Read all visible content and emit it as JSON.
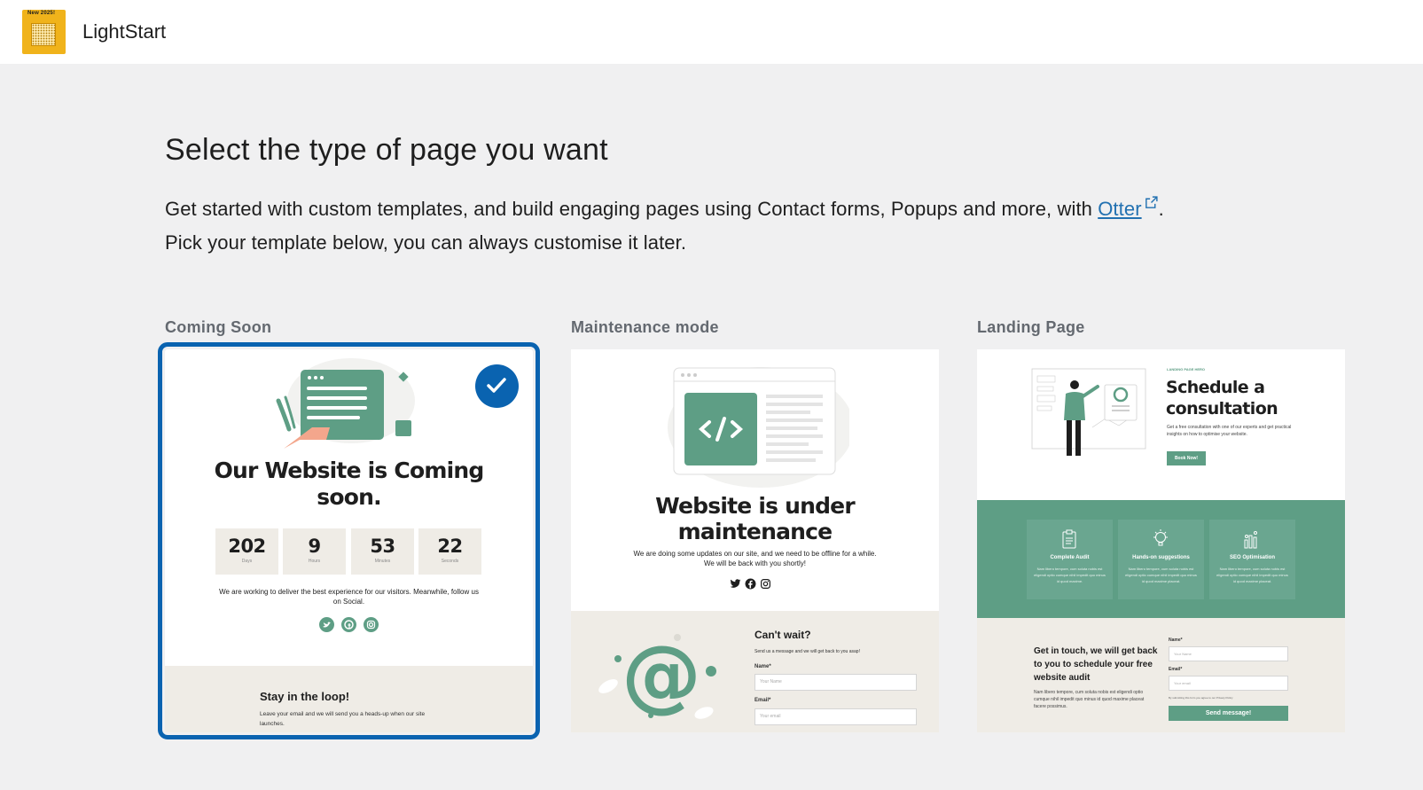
{
  "app": {
    "name": "LightStart",
    "logo_badge": "New 2025!"
  },
  "main": {
    "heading": "Select the type of page you want",
    "description_before_link": "Get started with custom templates, and build engaging pages using Contact forms, Popups and more, with ",
    "link_text": "Otter",
    "description_after_link": ".",
    "description_line2": "Pick your template below, you can always customise it later."
  },
  "templates": [
    {
      "label": "Coming Soon",
      "selected": true,
      "preview": {
        "title": "Our Website is Coming soon.",
        "countdown": [
          {
            "value": "202",
            "unit": "Days"
          },
          {
            "value": "9",
            "unit": "Hours"
          },
          {
            "value": "53",
            "unit": "Minutes"
          },
          {
            "value": "22",
            "unit": "Seconds"
          }
        ],
        "text": "We are working to deliver the best experience for our visitors. Meanwhile, follow us on Social.",
        "footer_title": "Stay in the loop!",
        "footer_text": "Leave your email and we will send you a heads-up when our site launches."
      }
    },
    {
      "label": "Maintenance mode",
      "selected": false,
      "preview": {
        "title": "Website is under maintenance",
        "text": "We are doing some updates on our site, and we need to be offline for a while. We will be back with you shortly!",
        "contact_title": "Can't wait?",
        "contact_text": "Send us a message and we will get back to you asap!",
        "name_label": "Name*",
        "name_placeholder": "Your Name",
        "email_label": "Email*",
        "email_placeholder": "Your email"
      }
    },
    {
      "label": "Landing Page",
      "selected": false,
      "preview": {
        "eyebrow": "LANDING PAGE HERO",
        "title": "Schedule a consultation",
        "text": "Get a free consultation with one of our experts and get practical insights on how to optimise your website.",
        "button": "Book Now!",
        "features": [
          {
            "title": "Complete Audit",
            "text": "Nam libero tempore, cum soluta nobis est eligendi optio cumque nihil impedit quo minus id quod maxime."
          },
          {
            "title": "Hands-on suggestions",
            "text": "Nam libero tempore, cum soluta nobis est eligendi optio cumque nihil impedit quo minus id quod maxime placeat."
          },
          {
            "title": "SEO Optimisation",
            "text": "Nam libero tempore, cum soluta nobis est eligendi optio cumque nihil impedit quo minus id quod maxime placeat."
          }
        ],
        "contact_title": "Get in touch, we will get back to you to schedule your free website audit",
        "contact_text": "Nam libero tempore, cum soluta nobis est eligendi optio cumque nihil impedit quo minus id quod maxime placeat facere possimus.",
        "name_label": "Name*",
        "name_placeholder": "Your Name",
        "email_label": "Email*",
        "email_placeholder": "Your email",
        "consent": "By submitting this form you agree to our Privacy Policy",
        "submit": "Send message!"
      }
    }
  ],
  "colors": {
    "accent": "#0a63b0",
    "link": "#2271b1",
    "template_green": "#5e9e85",
    "template_beige": "#efece6",
    "logo_yellow": "#f0b31b"
  }
}
